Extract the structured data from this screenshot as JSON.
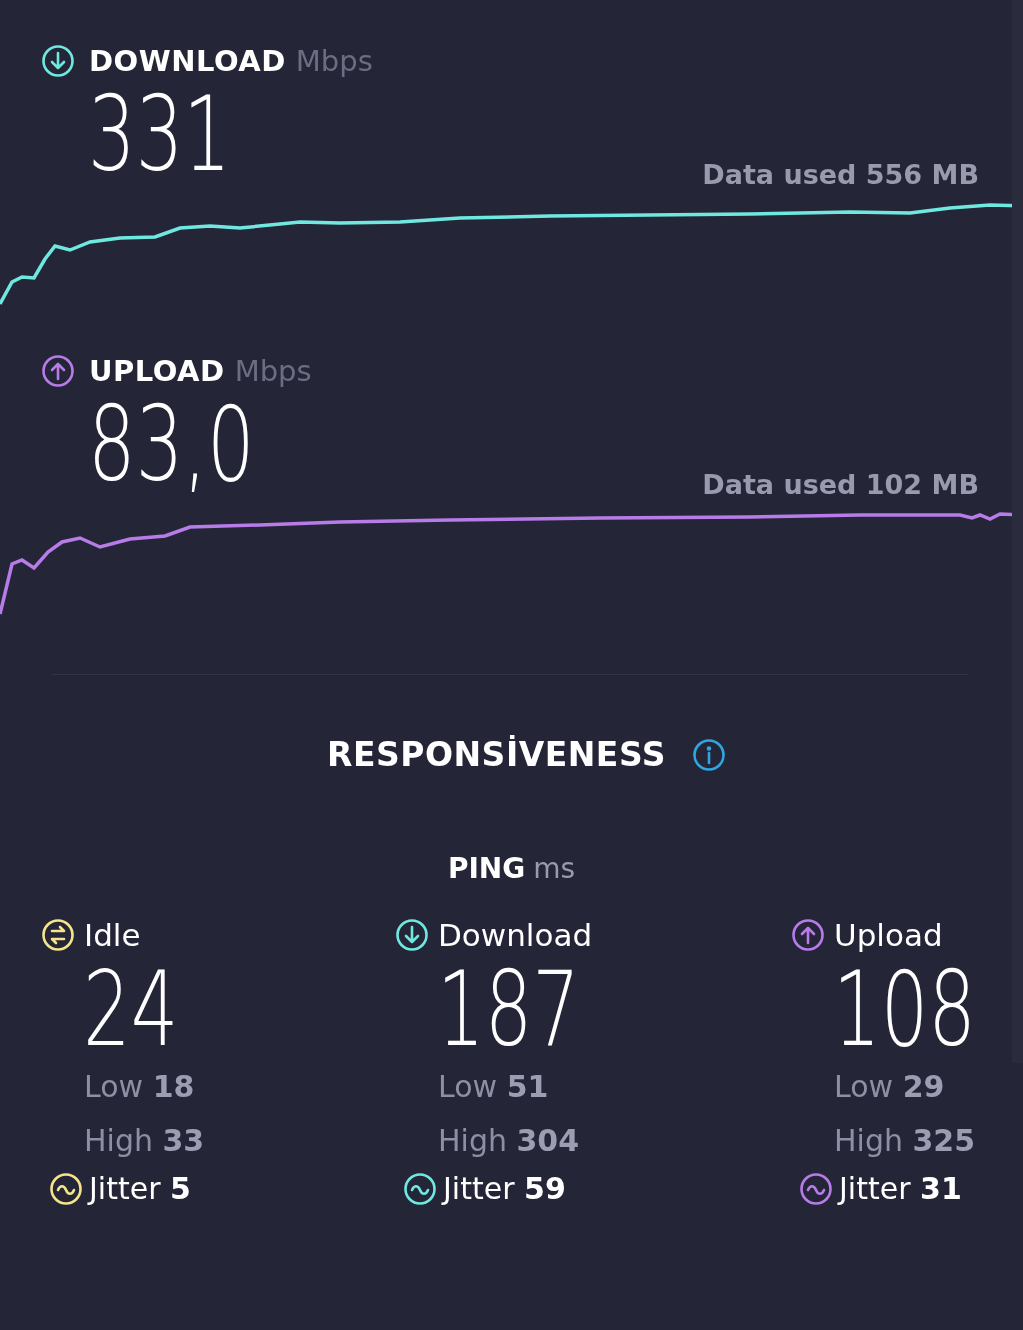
{
  "tests": [
    {
      "kind": "download",
      "label": "DOWNLOAD",
      "unit": "Mbps",
      "value": "331",
      "data_used": "Data used 556 MB",
      "color": "#6fe9df"
    },
    {
      "kind": "upload",
      "label": "UPLOAD",
      "unit": "Mbps",
      "value": "83,0",
      "data_used": "Data used 102 MB",
      "color": "#b77ce8"
    }
  ],
  "responsiveness": {
    "title": "RESPONSİVENESS"
  },
  "ping": {
    "label": "PING",
    "unit": "ms",
    "columns": [
      {
        "kind": "idle",
        "label": "Idle",
        "value": "24",
        "low": "Low **18**",
        "high": "High **33**",
        "jitter": "Jitter **5**",
        "color": "#f4e48a"
      },
      {
        "kind": "download",
        "label": "Download",
        "value": "187",
        "low": "Low **51**",
        "high": "High **304**",
        "jitter": "Jitter **59**",
        "color": "#6fe9df"
      },
      {
        "kind": "upload",
        "label": "Upload",
        "value": "108",
        "low": "Low **29**",
        "high": "High **325**",
        "jitter": "Jitter **31**",
        "color": "#b77ce8"
      }
    ]
  }
}
